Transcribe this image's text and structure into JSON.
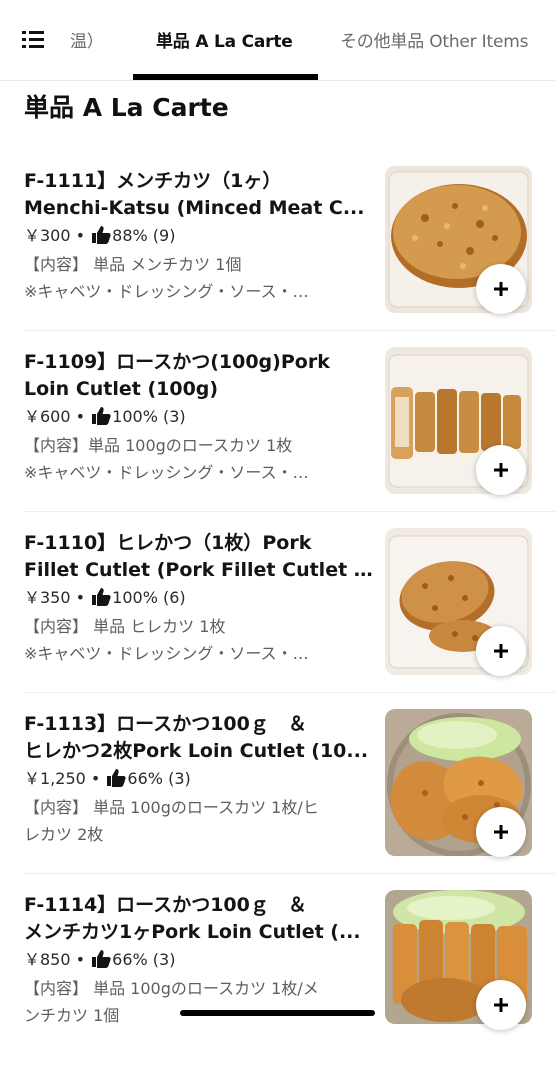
{
  "tabs": {
    "prev_label": "温）",
    "active_label": "単品 A La Carte",
    "next_label": "その他単品 Other Items"
  },
  "section": {
    "title": "単品 A La Carte"
  },
  "items": [
    {
      "title_line1": "F-1111】メンチカツ（1ヶ）",
      "title_line2": "Menchi-Katsu (Minced Meat C...",
      "price": "￥300",
      "rating": "88% (9)",
      "desc_line1": "【内容】 単品 メンチカツ 1個",
      "desc_line2": "※キャベツ・ドレッシング・ソース・…"
    },
    {
      "title_line1": "F-1109】ロースかつ(100g)Pork",
      "title_line2": "Loin Cutlet (100g)",
      "price": "￥600",
      "rating": "100% (3)",
      "desc_line1": "【内容】単品 100gのロースカツ 1枚",
      "desc_line2": "※キャベツ・ドレッシング・ソース・…"
    },
    {
      "title_line1": "F-1110】ヒレかつ（1枚）Pork",
      "title_line2": "Fillet Cutlet (Pork Fillet Cutlet 1...",
      "price": "￥350",
      "rating": "100% (6)",
      "desc_line1": "【内容】 単品 ヒレカツ 1枚",
      "desc_line2": "※キャベツ・ドレッシング・ソース・…"
    },
    {
      "title_line1": "F-1113】ロースかつ100ｇ　＆",
      "title_line2": "ヒレかつ2枚Pork Loin Cutlet (10...",
      "price": "￥1,250",
      "rating": "66% (3)",
      "desc_line1": "【内容】 単品 100gのロースカツ 1枚/ヒ",
      "desc_line2": "レカツ 2枚"
    },
    {
      "title_line1": "F-1114】ロースかつ100ｇ　＆",
      "title_line2": "メンチカツ1ヶPork Loin Cutlet (...",
      "price": "￥850",
      "rating": "66% (3)",
      "desc_line1": "【内容】 単品 100gのロースカツ 1枚/メ",
      "desc_line2": "ンチカツ 1個"
    }
  ],
  "icons": {
    "menu": "menu-icon",
    "thumbs_up": "thumbs-up-icon",
    "add": "plus-icon"
  },
  "colors": {
    "accent": "#000000",
    "text": "#141414",
    "muted": "#5e5e5e",
    "cutlet": "#c98a3c"
  }
}
